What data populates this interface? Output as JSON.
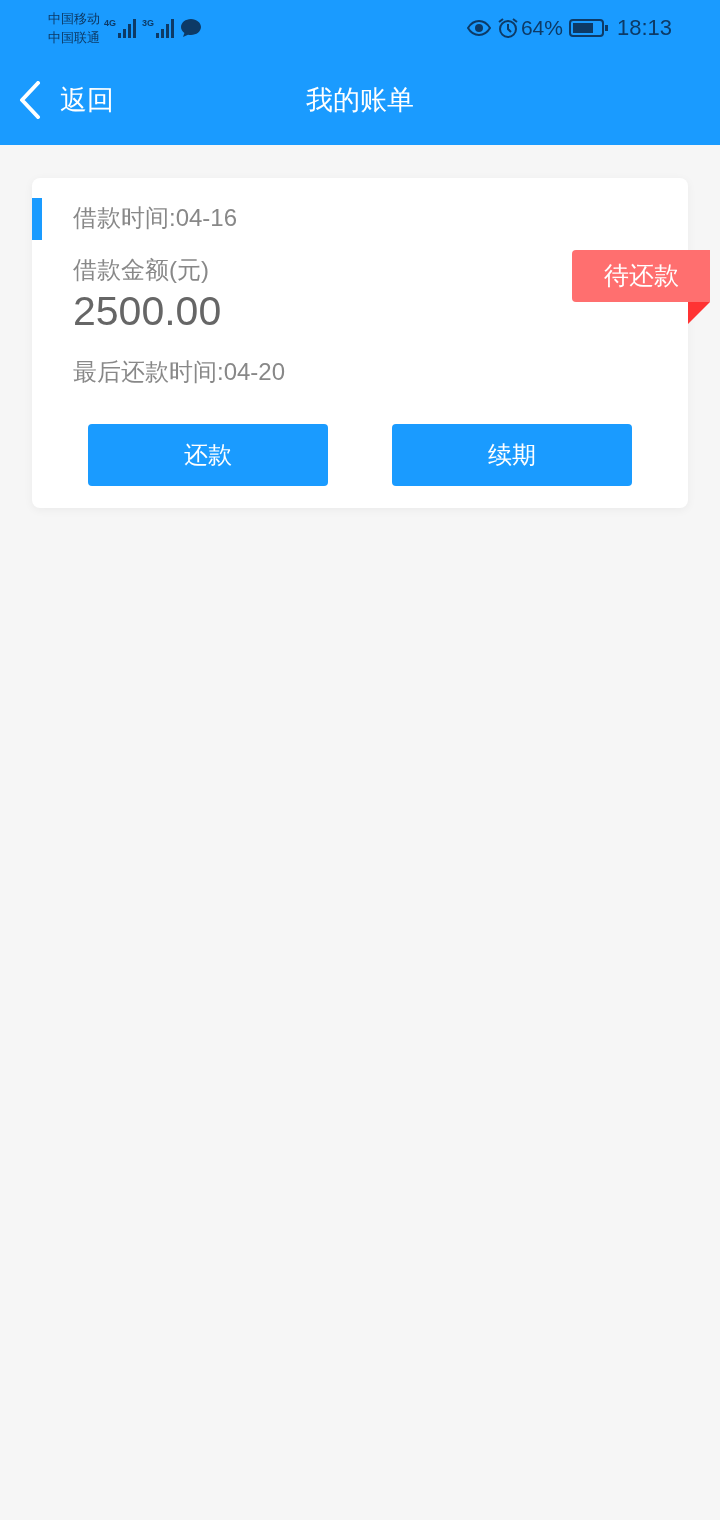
{
  "status_bar": {
    "carriers": [
      "中国移动",
      "中国联通"
    ],
    "networks": [
      "4G",
      "3G"
    ],
    "battery_percent": "64%",
    "time": "18:13"
  },
  "header": {
    "back_label": "返回",
    "title": "我的账单"
  },
  "bills": [
    {
      "loan_time": "借款时间:04-16",
      "amount_label": "借款金额(元)",
      "amount": "2500.00",
      "due_time": "最后还款时间:04-20",
      "status": "待还款",
      "buttons": [
        "还款",
        "续期"
      ]
    }
  ]
}
